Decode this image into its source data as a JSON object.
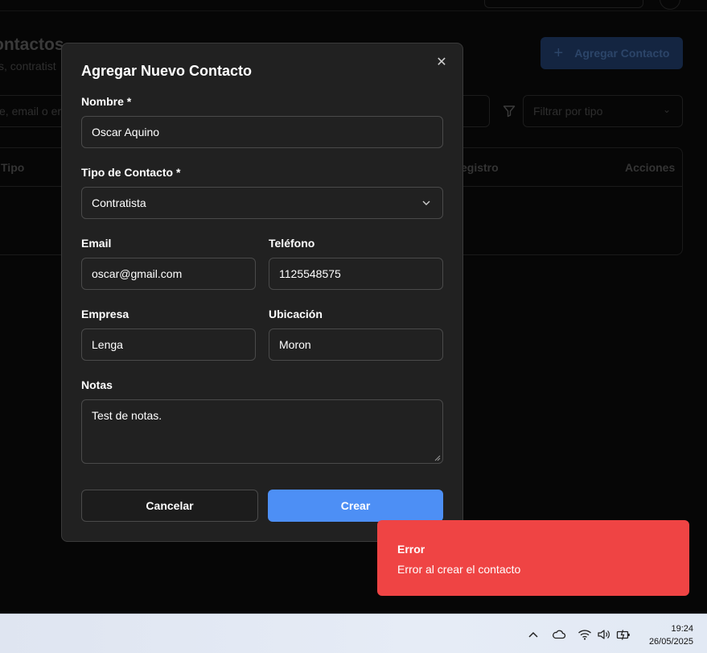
{
  "background": {
    "page_title": "ontactos",
    "page_subtitle": "s, contratist",
    "add_button_label": "Agregar Contacto",
    "search_placeholder": "e, email o em",
    "type_filter_placeholder": "Filtrar por tipo",
    "table_headers": {
      "type": "Tipo",
      "registered": "egistro",
      "actions": "Acciones"
    }
  },
  "modal": {
    "title": "Agregar Nuevo Contacto",
    "fields": {
      "name": {
        "label": "Nombre *",
        "value": "Oscar Aquino"
      },
      "contact_type": {
        "label": "Tipo de Contacto *",
        "value": "Contratista"
      },
      "email": {
        "label": "Email",
        "value": "oscar@gmail.com"
      },
      "phone": {
        "label": "Teléfono",
        "value": "1125548575"
      },
      "company": {
        "label": "Empresa",
        "value": "Lenga"
      },
      "location": {
        "label": "Ubicación",
        "value": "Moron"
      },
      "notes": {
        "label": "Notas",
        "value": "Test de notas."
      }
    },
    "cancel_label": "Cancelar",
    "create_label": "Crear"
  },
  "toast": {
    "title": "Error",
    "message": "Error al crear el contacto",
    "color": "#ef4444"
  },
  "taskbar": {
    "time": "19:24",
    "date": "26/05/2025",
    "icons": [
      "chevron-up-icon",
      "onedrive-cloud-icon",
      "wifi-icon",
      "volume-icon",
      "battery-icon"
    ]
  },
  "colors": {
    "accent": "#4d8ff5",
    "modal_bg": "#212121",
    "page_bg": "#060606"
  }
}
